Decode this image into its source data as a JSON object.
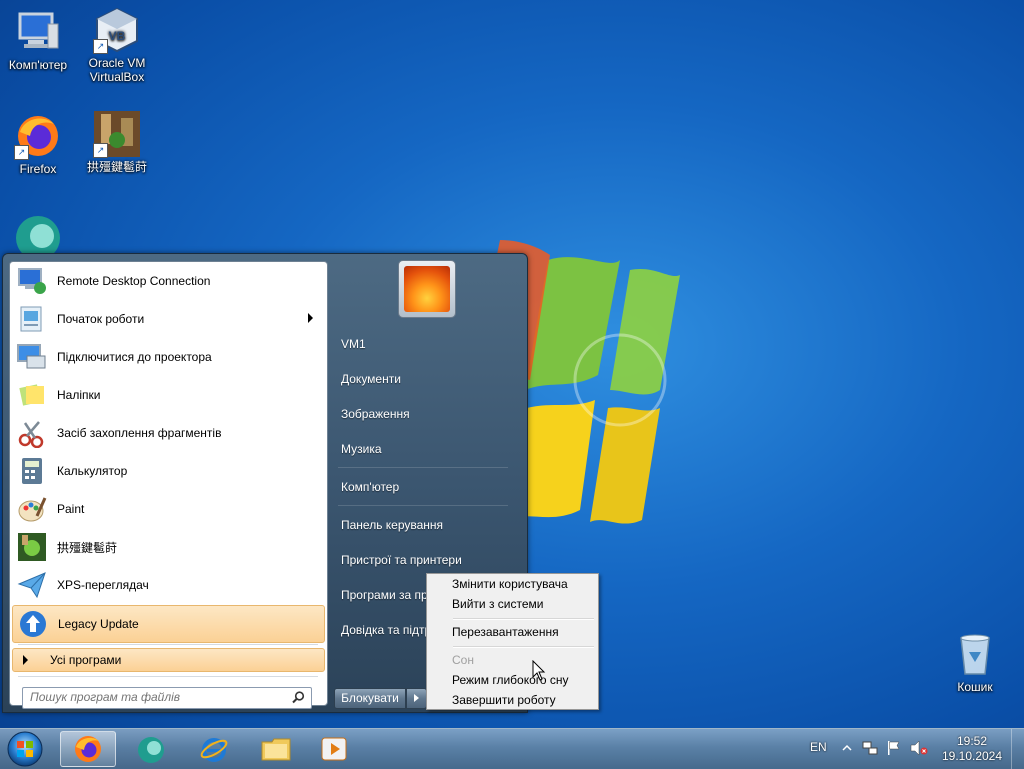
{
  "desktop": {
    "icons": [
      {
        "label": "Комп'ютер",
        "icon": "computer-icon"
      },
      {
        "label": "Oracle VM VirtualBox",
        "icon": "virtualbox-icon"
      },
      {
        "label": "Firefox",
        "icon": "firefox-icon"
      },
      {
        "label": "拱殭鍵髱莳",
        "icon": "game-icon"
      },
      {
        "label": "Кошик",
        "icon": "recycle-bin-icon"
      }
    ]
  },
  "start_menu": {
    "programs": [
      {
        "label": "Remote Desktop Connection",
        "icon": "remote-desktop-icon"
      },
      {
        "label": "Початок роботи",
        "icon": "getting-started-icon",
        "has_submenu": true
      },
      {
        "label": "Підключитися до проектора",
        "icon": "projector-icon"
      },
      {
        "label": "Наліпки",
        "icon": "sticky-notes-icon"
      },
      {
        "label": "Засіб захоплення фрагментів",
        "icon": "snipping-tool-icon"
      },
      {
        "label": "Калькулятор",
        "icon": "calculator-icon"
      },
      {
        "label": "Paint",
        "icon": "paint-icon"
      },
      {
        "label": "拱殭鍵髱莳",
        "icon": "game-icon"
      },
      {
        "label": "XPS-переглядач",
        "icon": "xps-viewer-icon"
      },
      {
        "label": "Legacy Update",
        "icon": "legacy-update-icon"
      }
    ],
    "all_programs": "Усі програми",
    "search_placeholder": "Пошук програм та файлів",
    "right": [
      {
        "label": "VM1"
      },
      {
        "label": "Документи"
      },
      {
        "label": "Зображення"
      },
      {
        "label": "Музика"
      },
      {
        "label": "Комп'ютер"
      },
      {
        "label": "Панель керування"
      },
      {
        "label": "Пристрої та принтери"
      },
      {
        "label": "Програми за промовчанням"
      },
      {
        "label": "Довідка та підтримка"
      }
    ],
    "lock_label": "Блокувати"
  },
  "context_menu": {
    "items": [
      {
        "label": "Змінити користувача",
        "disabled": false
      },
      {
        "label": "Вийти з системи",
        "disabled": false
      },
      {
        "label": "Перезавантаження",
        "disabled": false
      },
      {
        "label": "Сон",
        "disabled": true
      },
      {
        "label": "Режим глибокого сну",
        "disabled": false
      },
      {
        "label": "Завершити роботу",
        "disabled": false
      }
    ]
  },
  "taskbar": {
    "pinned": [
      "firefox-icon",
      "teal-app-icon",
      "internet-explorer-icon",
      "explorer-icon",
      "media-player-icon"
    ],
    "language": "EN",
    "time": "19:52",
    "date": "19.10.2024"
  }
}
